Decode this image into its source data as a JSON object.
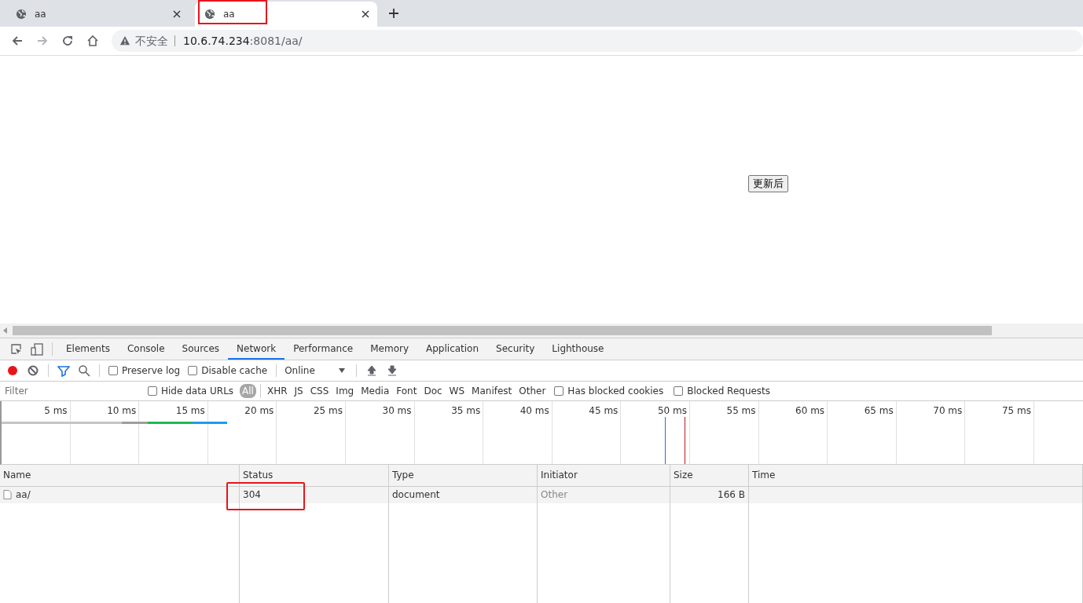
{
  "browser_tabs": [
    {
      "title": "aa",
      "selected": false
    },
    {
      "title": "aa",
      "selected": true
    }
  ],
  "address_bar": {
    "security_label": "不安全",
    "host": "10.6.74.234",
    "rest": ":8081/aa/"
  },
  "page": {
    "button": "更新后"
  },
  "devtools_tabs": [
    {
      "label": "Elements",
      "selected": false
    },
    {
      "label": "Console",
      "selected": false
    },
    {
      "label": "Sources",
      "selected": false
    },
    {
      "label": "Network",
      "selected": true
    },
    {
      "label": "Performance",
      "selected": false
    },
    {
      "label": "Memory",
      "selected": false
    },
    {
      "label": "Application",
      "selected": false
    },
    {
      "label": "Security",
      "selected": false
    },
    {
      "label": "Lighthouse",
      "selected": false
    }
  ],
  "toolbar": {
    "recording": true,
    "preserve_log": {
      "label": "Preserve log",
      "checked": false
    },
    "disable_cache": {
      "label": "Disable cache",
      "checked": false
    },
    "throttling": "Online"
  },
  "filter_bar": {
    "placeholder": "Filter",
    "hide_data_urls": {
      "label": "Hide data URLs",
      "checked": false
    },
    "types": [
      {
        "label": "All",
        "selected": true
      },
      {
        "label": "XHR",
        "selected": false
      },
      {
        "label": "JS",
        "selected": false
      },
      {
        "label": "CSS",
        "selected": false
      },
      {
        "label": "Img",
        "selected": false
      },
      {
        "label": "Media",
        "selected": false
      },
      {
        "label": "Font",
        "selected": false
      },
      {
        "label": "Doc",
        "selected": false
      },
      {
        "label": "WS",
        "selected": false
      },
      {
        "label": "Manifest",
        "selected": false
      },
      {
        "label": "Other",
        "selected": false
      }
    ],
    "has_blocked_cookies": {
      "label": "Has blocked cookies",
      "checked": false
    },
    "blocked_requests": {
      "label": "Blocked Requests",
      "checked": false
    }
  },
  "overview": {
    "ticks": [
      "5 ms",
      "10 ms",
      "15 ms",
      "20 ms",
      "25 ms",
      "30 ms",
      "35 ms",
      "40 ms",
      "45 ms",
      "50 ms",
      "55 ms",
      "60 ms",
      "65 ms",
      "70 ms",
      "75 ms"
    ]
  },
  "table": {
    "columns": [
      "Name",
      "Status",
      "Type",
      "Initiator",
      "Size",
      "Time"
    ],
    "rows": [
      {
        "name": "aa/",
        "status": "304",
        "type": "document",
        "initiator": "Other",
        "size": "166 B"
      }
    ]
  }
}
